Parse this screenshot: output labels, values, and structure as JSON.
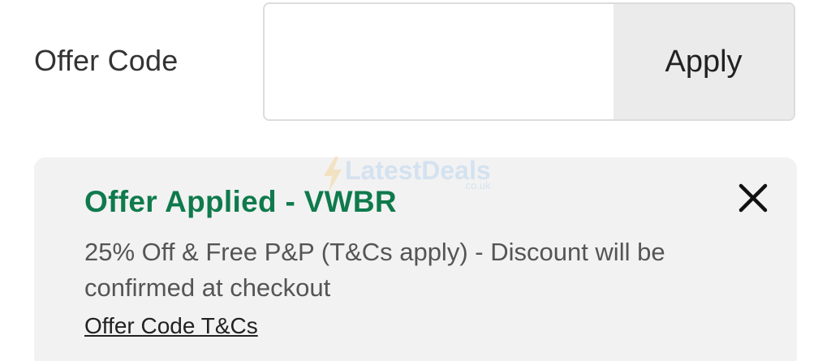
{
  "offer_code": {
    "label": "Offer Code",
    "input_value": "",
    "input_placeholder": "",
    "apply_label": "Apply"
  },
  "offer_applied": {
    "title": "Offer Applied - VWBR",
    "description": "25% Off & Free P&P (T&Cs apply) - Discount will be confirmed at checkout",
    "terms_link": "Offer Code T&Cs",
    "close_icon": "close-icon"
  },
  "watermark": {
    "text": "LatestDeals",
    "sub": ".co.uk"
  },
  "colors": {
    "accent_green": "#0f7a4c",
    "card_bg": "#f2f2f2",
    "button_bg": "#ebebeb"
  }
}
